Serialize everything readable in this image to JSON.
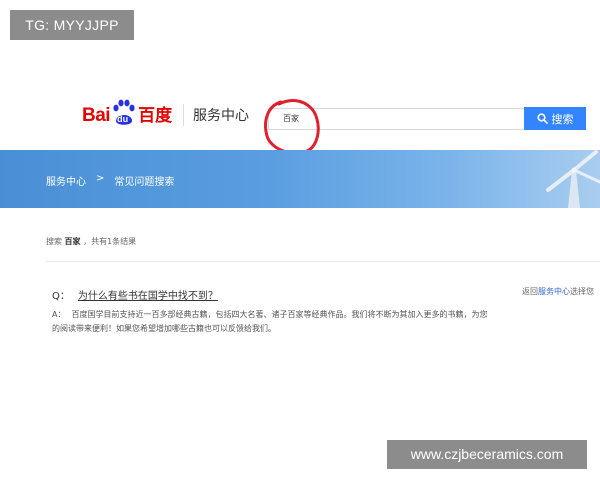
{
  "watermark_tag": "TG: MYYJJPP",
  "header": {
    "logo_latin_1": "Bai",
    "logo_du": "du",
    "logo_cn": "百度",
    "service_title": "服务中心",
    "search_value": "百家",
    "search_button_label": "搜索"
  },
  "colors": {
    "brand_red": "#e10601",
    "search_blue": "#3385ff",
    "banner_blue": "#4a8fd6",
    "annotation_red": "#e0202a"
  },
  "banner": {
    "crumb_home": "服务中心",
    "crumb_sep": ">",
    "crumb_current": "常见问题搜索"
  },
  "results": {
    "prefix": "搜索",
    "keyword": "百家",
    "suffix": "，共有1条结果"
  },
  "qa": {
    "q_label": "Q：",
    "question": "为什么有些书在国学中找不到？",
    "a_label": "A：",
    "answer": "百度国学目前支持近一百多部经典古籍，包括四大名著、诸子百家等经典作品。我们将不断为其加入更多的书籍，为您的阅读带来便利！如果您希望增加哪些古籍也可以反馈给我们。"
  },
  "side_note": {
    "prefix": "返回",
    "link": "服务中心",
    "suffix": "选择您"
  },
  "site_watermark": "www.czjbeceramics.com"
}
